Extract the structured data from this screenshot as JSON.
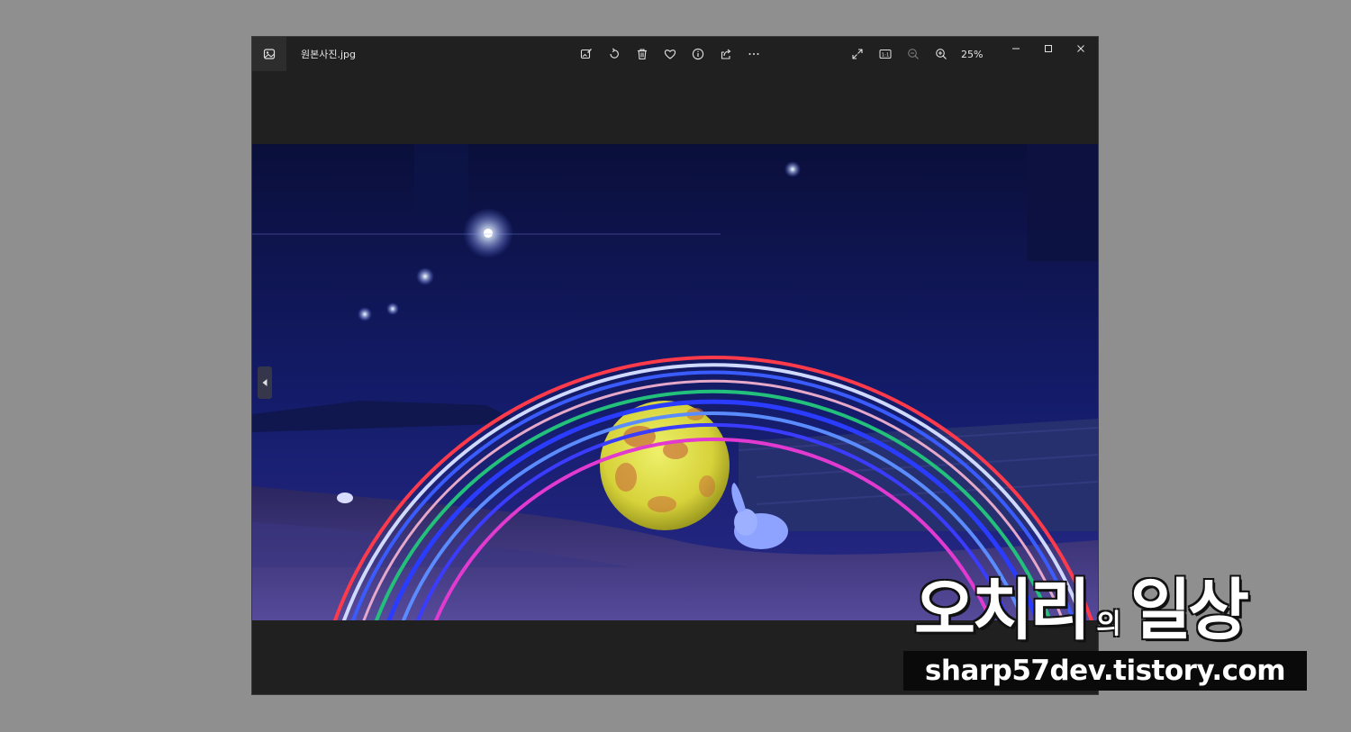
{
  "window": {
    "filename": "원본사진.jpg",
    "zoom_level": "25%"
  },
  "toolbar": {
    "icons": [
      "edit-image-icon",
      "rotate-icon",
      "delete-icon",
      "favorite-icon",
      "info-icon",
      "share-icon",
      "more-icon"
    ]
  },
  "right_tools": {
    "icons": [
      "fullscreen-icon",
      "actual-size-icon",
      "zoom-out-icon",
      "zoom-in-icon"
    ],
    "actual_size_label": "1:1"
  },
  "watermark": {
    "title_part1": "오치리",
    "title_connector": "의",
    "title_part2": "일상",
    "url": "sharp57dev.tistory.com"
  },
  "colors": {
    "background": "#8f8f8f",
    "window": "#202020",
    "icon": "#e0e0e0"
  }
}
